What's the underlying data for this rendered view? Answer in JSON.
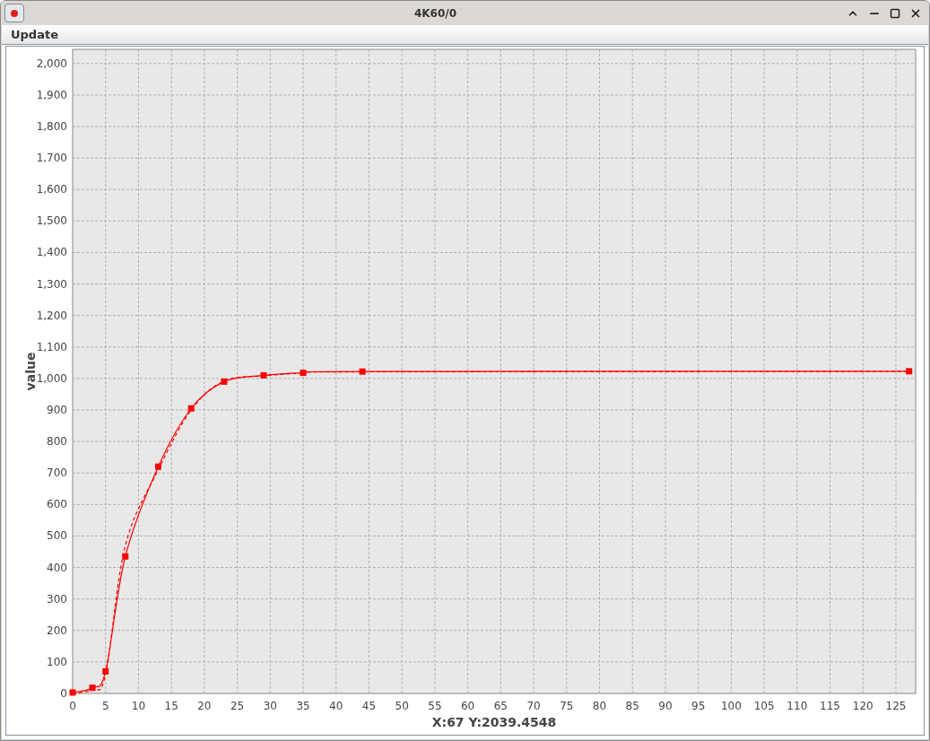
{
  "window": {
    "title": "4K60/0"
  },
  "menu": [
    {
      "label": "Update"
    }
  ],
  "chart_data": {
    "type": "line",
    "ylabel": "value",
    "xlabel": "X:67 Y:2039.4548",
    "x": [
      0,
      3,
      5,
      8,
      13,
      18,
      23,
      29,
      35,
      44,
      127
    ],
    "series": [
      {
        "color": "#ff0000",
        "line_style": "solid",
        "marker": "square",
        "values": [
          3,
          18,
          70,
          435,
          720,
          905,
          990,
          1010,
          1018,
          1022,
          1023
        ]
      },
      {
        "color": "#ff0000",
        "line_style": "dashed",
        "values": [
          0,
          12,
          60,
          470,
          710,
          900,
          992,
          1008,
          1017,
          1021,
          1023
        ]
      }
    ],
    "grid": true,
    "xlim": [
      0,
      128
    ],
    "ylim": [
      0,
      2045
    ],
    "xticks": [
      0,
      5,
      10,
      15,
      20,
      25,
      30,
      35,
      40,
      45,
      50,
      55,
      60,
      65,
      70,
      75,
      80,
      85,
      90,
      95,
      100,
      105,
      110,
      115,
      120,
      125
    ],
    "yticks": [
      {
        "value": 0,
        "label": "0"
      },
      {
        "value": 100,
        "label": "100"
      },
      {
        "value": 200,
        "label": "200"
      },
      {
        "value": 300,
        "label": "300"
      },
      {
        "value": 400,
        "label": "400"
      },
      {
        "value": 500,
        "label": "500"
      },
      {
        "value": 600,
        "label": "600"
      },
      {
        "value": 700,
        "label": "700"
      },
      {
        "value": 800,
        "label": "800"
      },
      {
        "value": 900,
        "label": "900"
      },
      {
        "value": 1000,
        "label": "1,000"
      },
      {
        "value": 1100,
        "label": "1,100"
      },
      {
        "value": 1200,
        "label": "1,200"
      },
      {
        "value": 1300,
        "label": "1,300"
      },
      {
        "value": 1400,
        "label": "1,400"
      },
      {
        "value": 1500,
        "label": "1,500"
      },
      {
        "value": 1600,
        "label": "1,600"
      },
      {
        "value": 1700,
        "label": "1,700"
      },
      {
        "value": 1800,
        "label": "1,800"
      },
      {
        "value": 1900,
        "label": "1,900"
      },
      {
        "value": 2000,
        "label": "2,000"
      }
    ]
  }
}
